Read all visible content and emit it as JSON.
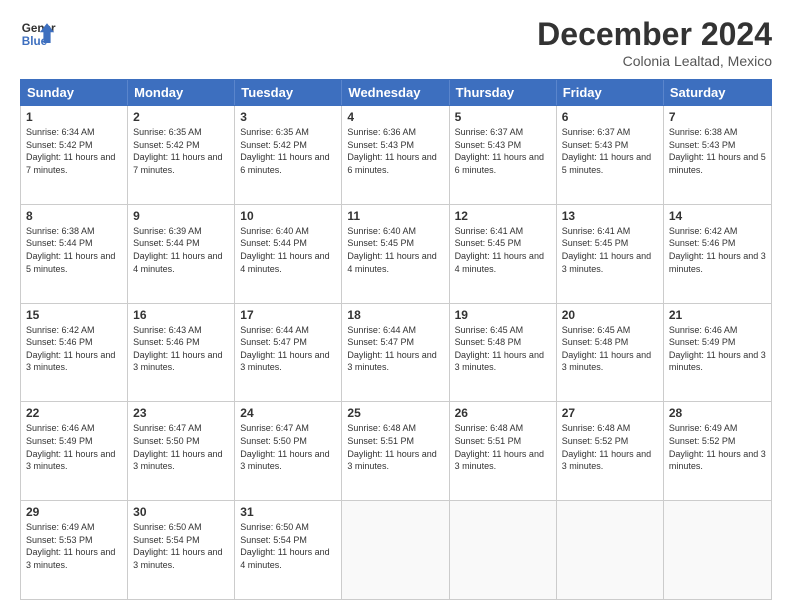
{
  "header": {
    "logo_line1": "General",
    "logo_line2": "Blue",
    "month": "December 2024",
    "location": "Colonia Lealtad, Mexico"
  },
  "days_of_week": [
    "Sunday",
    "Monday",
    "Tuesday",
    "Wednesday",
    "Thursday",
    "Friday",
    "Saturday"
  ],
  "weeks": [
    [
      {
        "day": 1,
        "sunrise": "6:34 AM",
        "sunset": "5:42 PM",
        "daylight": "11 hours and 7 minutes."
      },
      {
        "day": 2,
        "sunrise": "6:35 AM",
        "sunset": "5:42 PM",
        "daylight": "11 hours and 7 minutes."
      },
      {
        "day": 3,
        "sunrise": "6:35 AM",
        "sunset": "5:42 PM",
        "daylight": "11 hours and 6 minutes."
      },
      {
        "day": 4,
        "sunrise": "6:36 AM",
        "sunset": "5:43 PM",
        "daylight": "11 hours and 6 minutes."
      },
      {
        "day": 5,
        "sunrise": "6:37 AM",
        "sunset": "5:43 PM",
        "daylight": "11 hours and 6 minutes."
      },
      {
        "day": 6,
        "sunrise": "6:37 AM",
        "sunset": "5:43 PM",
        "daylight": "11 hours and 5 minutes."
      },
      {
        "day": 7,
        "sunrise": "6:38 AM",
        "sunset": "5:43 PM",
        "daylight": "11 hours and 5 minutes."
      }
    ],
    [
      {
        "day": 8,
        "sunrise": "6:38 AM",
        "sunset": "5:44 PM",
        "daylight": "11 hours and 5 minutes."
      },
      {
        "day": 9,
        "sunrise": "6:39 AM",
        "sunset": "5:44 PM",
        "daylight": "11 hours and 4 minutes."
      },
      {
        "day": 10,
        "sunrise": "6:40 AM",
        "sunset": "5:44 PM",
        "daylight": "11 hours and 4 minutes."
      },
      {
        "day": 11,
        "sunrise": "6:40 AM",
        "sunset": "5:45 PM",
        "daylight": "11 hours and 4 minutes."
      },
      {
        "day": 12,
        "sunrise": "6:41 AM",
        "sunset": "5:45 PM",
        "daylight": "11 hours and 4 minutes."
      },
      {
        "day": 13,
        "sunrise": "6:41 AM",
        "sunset": "5:45 PM",
        "daylight": "11 hours and 3 minutes."
      },
      {
        "day": 14,
        "sunrise": "6:42 AM",
        "sunset": "5:46 PM",
        "daylight": "11 hours and 3 minutes."
      }
    ],
    [
      {
        "day": 15,
        "sunrise": "6:42 AM",
        "sunset": "5:46 PM",
        "daylight": "11 hours and 3 minutes."
      },
      {
        "day": 16,
        "sunrise": "6:43 AM",
        "sunset": "5:46 PM",
        "daylight": "11 hours and 3 minutes."
      },
      {
        "day": 17,
        "sunrise": "6:44 AM",
        "sunset": "5:47 PM",
        "daylight": "11 hours and 3 minutes."
      },
      {
        "day": 18,
        "sunrise": "6:44 AM",
        "sunset": "5:47 PM",
        "daylight": "11 hours and 3 minutes."
      },
      {
        "day": 19,
        "sunrise": "6:45 AM",
        "sunset": "5:48 PM",
        "daylight": "11 hours and 3 minutes."
      },
      {
        "day": 20,
        "sunrise": "6:45 AM",
        "sunset": "5:48 PM",
        "daylight": "11 hours and 3 minutes."
      },
      {
        "day": 21,
        "sunrise": "6:46 AM",
        "sunset": "5:49 PM",
        "daylight": "11 hours and 3 minutes."
      }
    ],
    [
      {
        "day": 22,
        "sunrise": "6:46 AM",
        "sunset": "5:49 PM",
        "daylight": "11 hours and 3 minutes."
      },
      {
        "day": 23,
        "sunrise": "6:47 AM",
        "sunset": "5:50 PM",
        "daylight": "11 hours and 3 minutes."
      },
      {
        "day": 24,
        "sunrise": "6:47 AM",
        "sunset": "5:50 PM",
        "daylight": "11 hours and 3 minutes."
      },
      {
        "day": 25,
        "sunrise": "6:48 AM",
        "sunset": "5:51 PM",
        "daylight": "11 hours and 3 minutes."
      },
      {
        "day": 26,
        "sunrise": "6:48 AM",
        "sunset": "5:51 PM",
        "daylight": "11 hours and 3 minutes."
      },
      {
        "day": 27,
        "sunrise": "6:48 AM",
        "sunset": "5:52 PM",
        "daylight": "11 hours and 3 minutes."
      },
      {
        "day": 28,
        "sunrise": "6:49 AM",
        "sunset": "5:52 PM",
        "daylight": "11 hours and 3 minutes."
      }
    ],
    [
      {
        "day": 29,
        "sunrise": "6:49 AM",
        "sunset": "5:53 PM",
        "daylight": "11 hours and 3 minutes."
      },
      {
        "day": 30,
        "sunrise": "6:50 AM",
        "sunset": "5:54 PM",
        "daylight": "11 hours and 3 minutes."
      },
      {
        "day": 31,
        "sunrise": "6:50 AM",
        "sunset": "5:54 PM",
        "daylight": "11 hours and 4 minutes."
      },
      null,
      null,
      null,
      null
    ]
  ]
}
